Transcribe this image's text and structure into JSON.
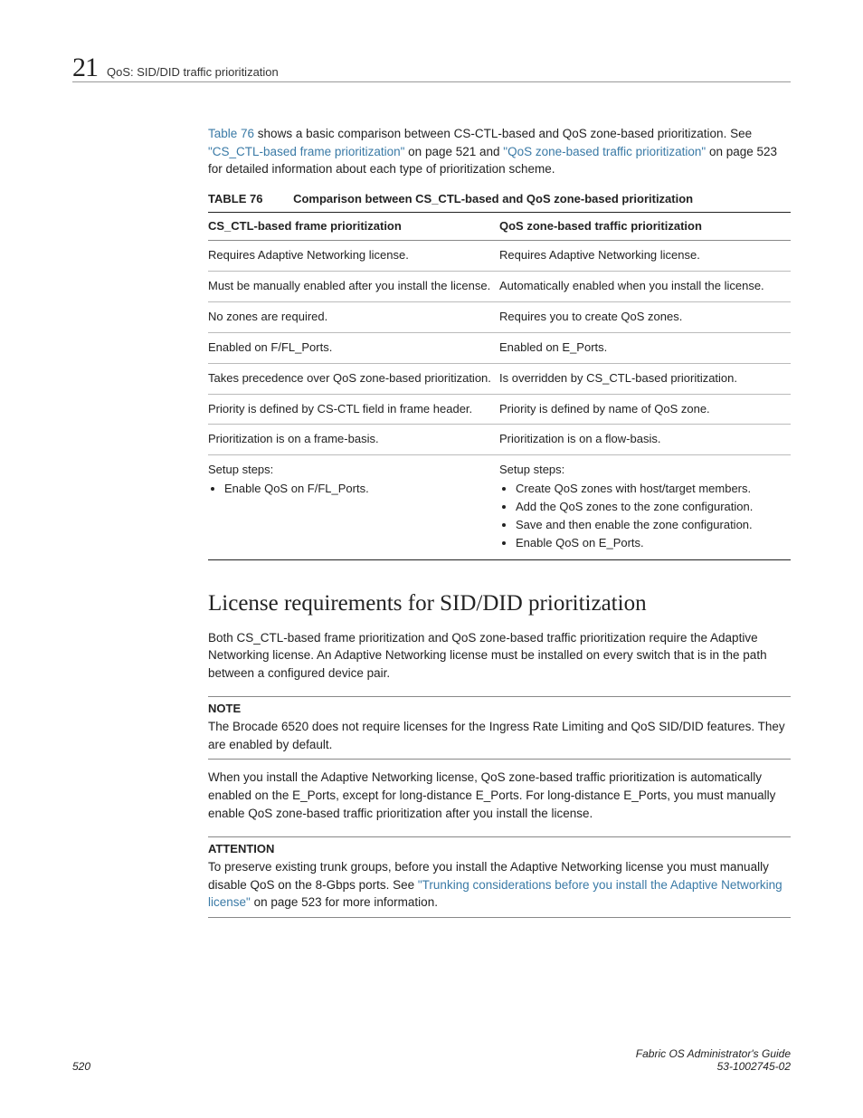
{
  "header": {
    "chapter_number": "21",
    "breadcrumb": "QoS: SID/DID traffic prioritization"
  },
  "intro": {
    "pre_link": "",
    "link1": "Table 76",
    "mid1": " shows a basic comparison between CS-CTL-based and QoS zone-based prioritization. See ",
    "link2": "\"CS_CTL-based frame prioritization\"",
    "mid2": " on page 521 and ",
    "link3": "\"QoS zone-based traffic prioritization\"",
    "mid3": " on page 523 for detailed information about each type of prioritization scheme."
  },
  "table": {
    "label": "TABLE 76",
    "title": "Comparison between CS_CTL-based and QoS zone-based prioritization",
    "head_left": "CS_CTL-based frame prioritization",
    "head_right": "QoS zone-based traffic prioritization",
    "rows": [
      {
        "l": "Requires Adaptive Networking license.",
        "r": "Requires Adaptive Networking license."
      },
      {
        "l": "Must be manually enabled after you install the license.",
        "r": "Automatically enabled when you install the license."
      },
      {
        "l": "No zones are required.",
        "r": "Requires you to create QoS zones."
      },
      {
        "l": "Enabled on F/FL_Ports.",
        "r": "Enabled on E_Ports."
      },
      {
        "l": "Takes precedence over QoS zone-based prioritization.",
        "r": "Is overridden by CS_CTL-based prioritization."
      },
      {
        "l": "Priority is defined by CS-CTL field in frame header.",
        "r": "Priority is defined by name of QoS zone."
      },
      {
        "l": "Prioritization is on a frame-basis.",
        "r": "Prioritization is on a flow-basis."
      }
    ],
    "setup_left_label": "Setup steps:",
    "setup_left_items": [
      "Enable QoS on F/FL_Ports."
    ],
    "setup_right_label": "Setup steps:",
    "setup_right_items": [
      "Create QoS zones with host/target members.",
      "Add the QoS zones to the zone configuration.",
      "Save and then enable the zone configuration.",
      "Enable QoS on E_Ports."
    ]
  },
  "section": {
    "title": "License requirements for SID/DID prioritization",
    "para1": "Both CS_CTL-based frame prioritization and QoS zone-based traffic prioritization require the Adaptive Networking license. An Adaptive Networking license must be installed on every switch that is in the path between a configured device pair.",
    "note_label": "NOTE",
    "note_body": "The Brocade 6520 does not require licenses for the Ingress Rate Limiting and QoS SID/DID features. They are enabled by default.",
    "para2": "When you install the Adaptive Networking license, QoS zone-based traffic prioritization is automatically enabled on the E_Ports, except for long-distance E_Ports. For long-distance E_Ports, you must manually enable QoS zone-based traffic prioritization after you install the license.",
    "attention_label": "ATTENTION",
    "attention_pre": "To preserve existing trunk groups, before you install the Adaptive Networking license you must manually disable QoS on the 8-Gbps ports. See ",
    "attention_link": "\"Trunking considerations before you install the Adaptive Networking license\"",
    "attention_post": " on page 523 for more information."
  },
  "footer": {
    "page_number": "520",
    "doc_title": "Fabric OS Administrator's Guide",
    "doc_id": "53-1002745-02"
  }
}
